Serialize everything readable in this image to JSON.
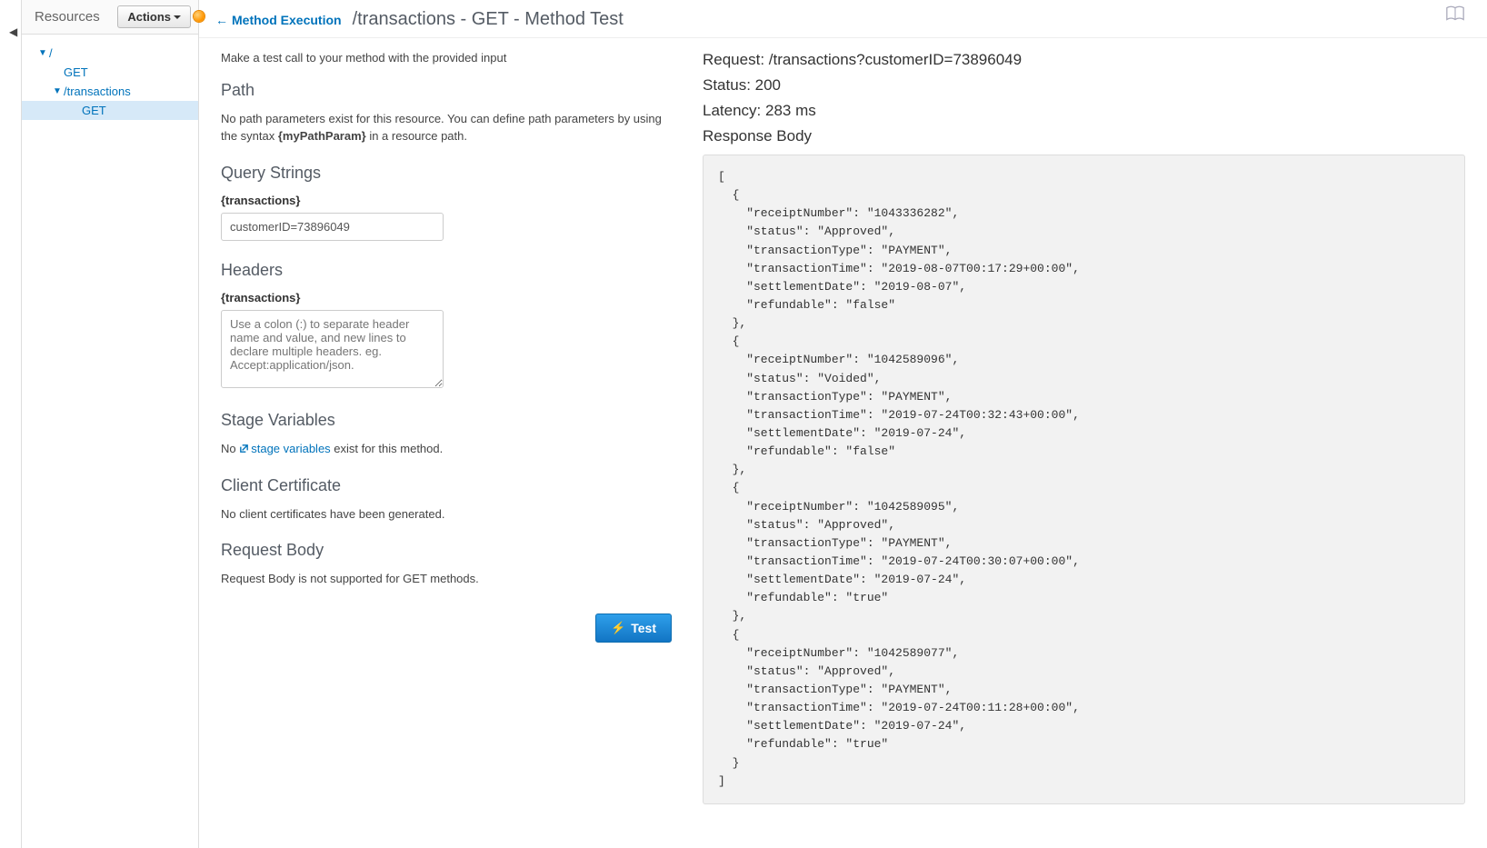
{
  "sidebar": {
    "title": "Resources",
    "actions_label": "Actions",
    "tree": {
      "root": "/",
      "root_get": "GET",
      "transactions": "/transactions",
      "transactions_get": "GET"
    }
  },
  "header": {
    "back": "Method Execution",
    "title": "/transactions - GET - Method Test"
  },
  "left": {
    "intro": "Make a test call to your method with the provided input",
    "path_heading": "Path",
    "path_text_a": "No path parameters exist for this resource. You can define path parameters by using the syntax ",
    "path_text_b": "{myPathParam}",
    "path_text_c": " in a resource path.",
    "qs_heading": "Query Strings",
    "qs_field_label": "{transactions}",
    "qs_value": "customerID=73896049",
    "headers_heading": "Headers",
    "headers_field_label": "{transactions}",
    "headers_placeholder": "Use a colon (:) to separate header name and value, and new lines to declare multiple headers. eg. Accept:application/json.",
    "stage_heading": "Stage Variables",
    "stage_no": "No ",
    "stage_link": "stage variables",
    "stage_rest": " exist for this method.",
    "cert_heading": "Client Certificate",
    "cert_text": "No client certificates have been generated.",
    "body_heading": "Request Body",
    "body_text": "Request Body is not supported for GET methods.",
    "test_label": "Test"
  },
  "right": {
    "request_label": "Request: ",
    "request_value": "/transactions?customerID=73896049",
    "status_label": "Status: ",
    "status_value": "200",
    "latency_label": "Latency: ",
    "latency_value": "283 ms",
    "response_body_label": "Response Body",
    "response_body": "[\n  {\n    \"receiptNumber\": \"1043336282\",\n    \"status\": \"Approved\",\n    \"transactionType\": \"PAYMENT\",\n    \"transactionTime\": \"2019-08-07T00:17:29+00:00\",\n    \"settlementDate\": \"2019-08-07\",\n    \"refundable\": \"false\"\n  },\n  {\n    \"receiptNumber\": \"1042589096\",\n    \"status\": \"Voided\",\n    \"transactionType\": \"PAYMENT\",\n    \"transactionTime\": \"2019-07-24T00:32:43+00:00\",\n    \"settlementDate\": \"2019-07-24\",\n    \"refundable\": \"false\"\n  },\n  {\n    \"receiptNumber\": \"1042589095\",\n    \"status\": \"Approved\",\n    \"transactionType\": \"PAYMENT\",\n    \"transactionTime\": \"2019-07-24T00:30:07+00:00\",\n    \"settlementDate\": \"2019-07-24\",\n    \"refundable\": \"true\"\n  },\n  {\n    \"receiptNumber\": \"1042589077\",\n    \"status\": \"Approved\",\n    \"transactionType\": \"PAYMENT\",\n    \"transactionTime\": \"2019-07-24T00:11:28+00:00\",\n    \"settlementDate\": \"2019-07-24\",\n    \"refundable\": \"true\"\n  }\n]"
  }
}
